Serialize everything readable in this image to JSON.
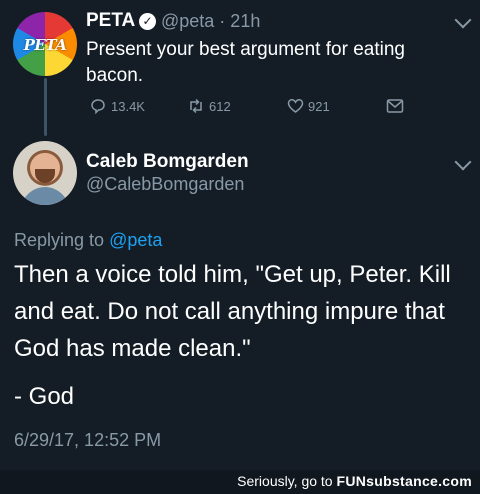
{
  "tweet1": {
    "author": "PETA",
    "avatar_text": "PETA",
    "handle_time": "@peta · 21h",
    "text": "Present your best argument for eating bacon.",
    "replies": "13.4K",
    "retweets": "612",
    "likes": "921"
  },
  "tweet2": {
    "author": "Caleb Bomgarden",
    "handle": "@CalebBomgarden",
    "replying_prefix": "Replying to ",
    "replying_handle": "@peta",
    "text": "Then a voice told him, \"Get up, Peter. Kill and eat. Do not call anything impure that God has made clean.\"",
    "signature": "- God",
    "timestamp": "6/29/17, 12:52 PM"
  },
  "footer": {
    "text": "Seriously, go to ",
    "brand": "FUNsubstance.com"
  },
  "colors": {
    "background": "#141d26",
    "muted": "#8899a6",
    "link": "#1da1f2"
  }
}
